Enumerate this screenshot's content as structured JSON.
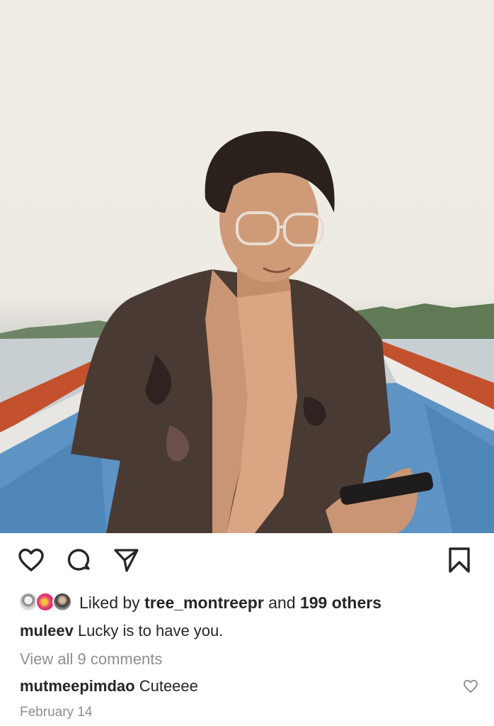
{
  "post": {
    "image_alt": "",
    "liked_by_prefix": "Liked by ",
    "liked_by_user": "tree_montreepr",
    "liked_by_middle": " and ",
    "liked_by_others": "199 others",
    "caption_user": "muleev",
    "caption_text": " Lucky is to have you.",
    "view_all_comments": "View all 9 comments",
    "comment_user": "mutmeepimdao",
    "comment_text": " Cuteeee",
    "date": "February 14"
  },
  "icons": {
    "like": "heart-icon",
    "comment": "comment-bubble-icon",
    "share": "paper-plane-icon",
    "save": "bookmark-icon",
    "comment_like": "small-heart-icon"
  },
  "colors": {
    "text": "#262626",
    "secondary_text": "#8e8e8e",
    "background": "#ffffff"
  }
}
